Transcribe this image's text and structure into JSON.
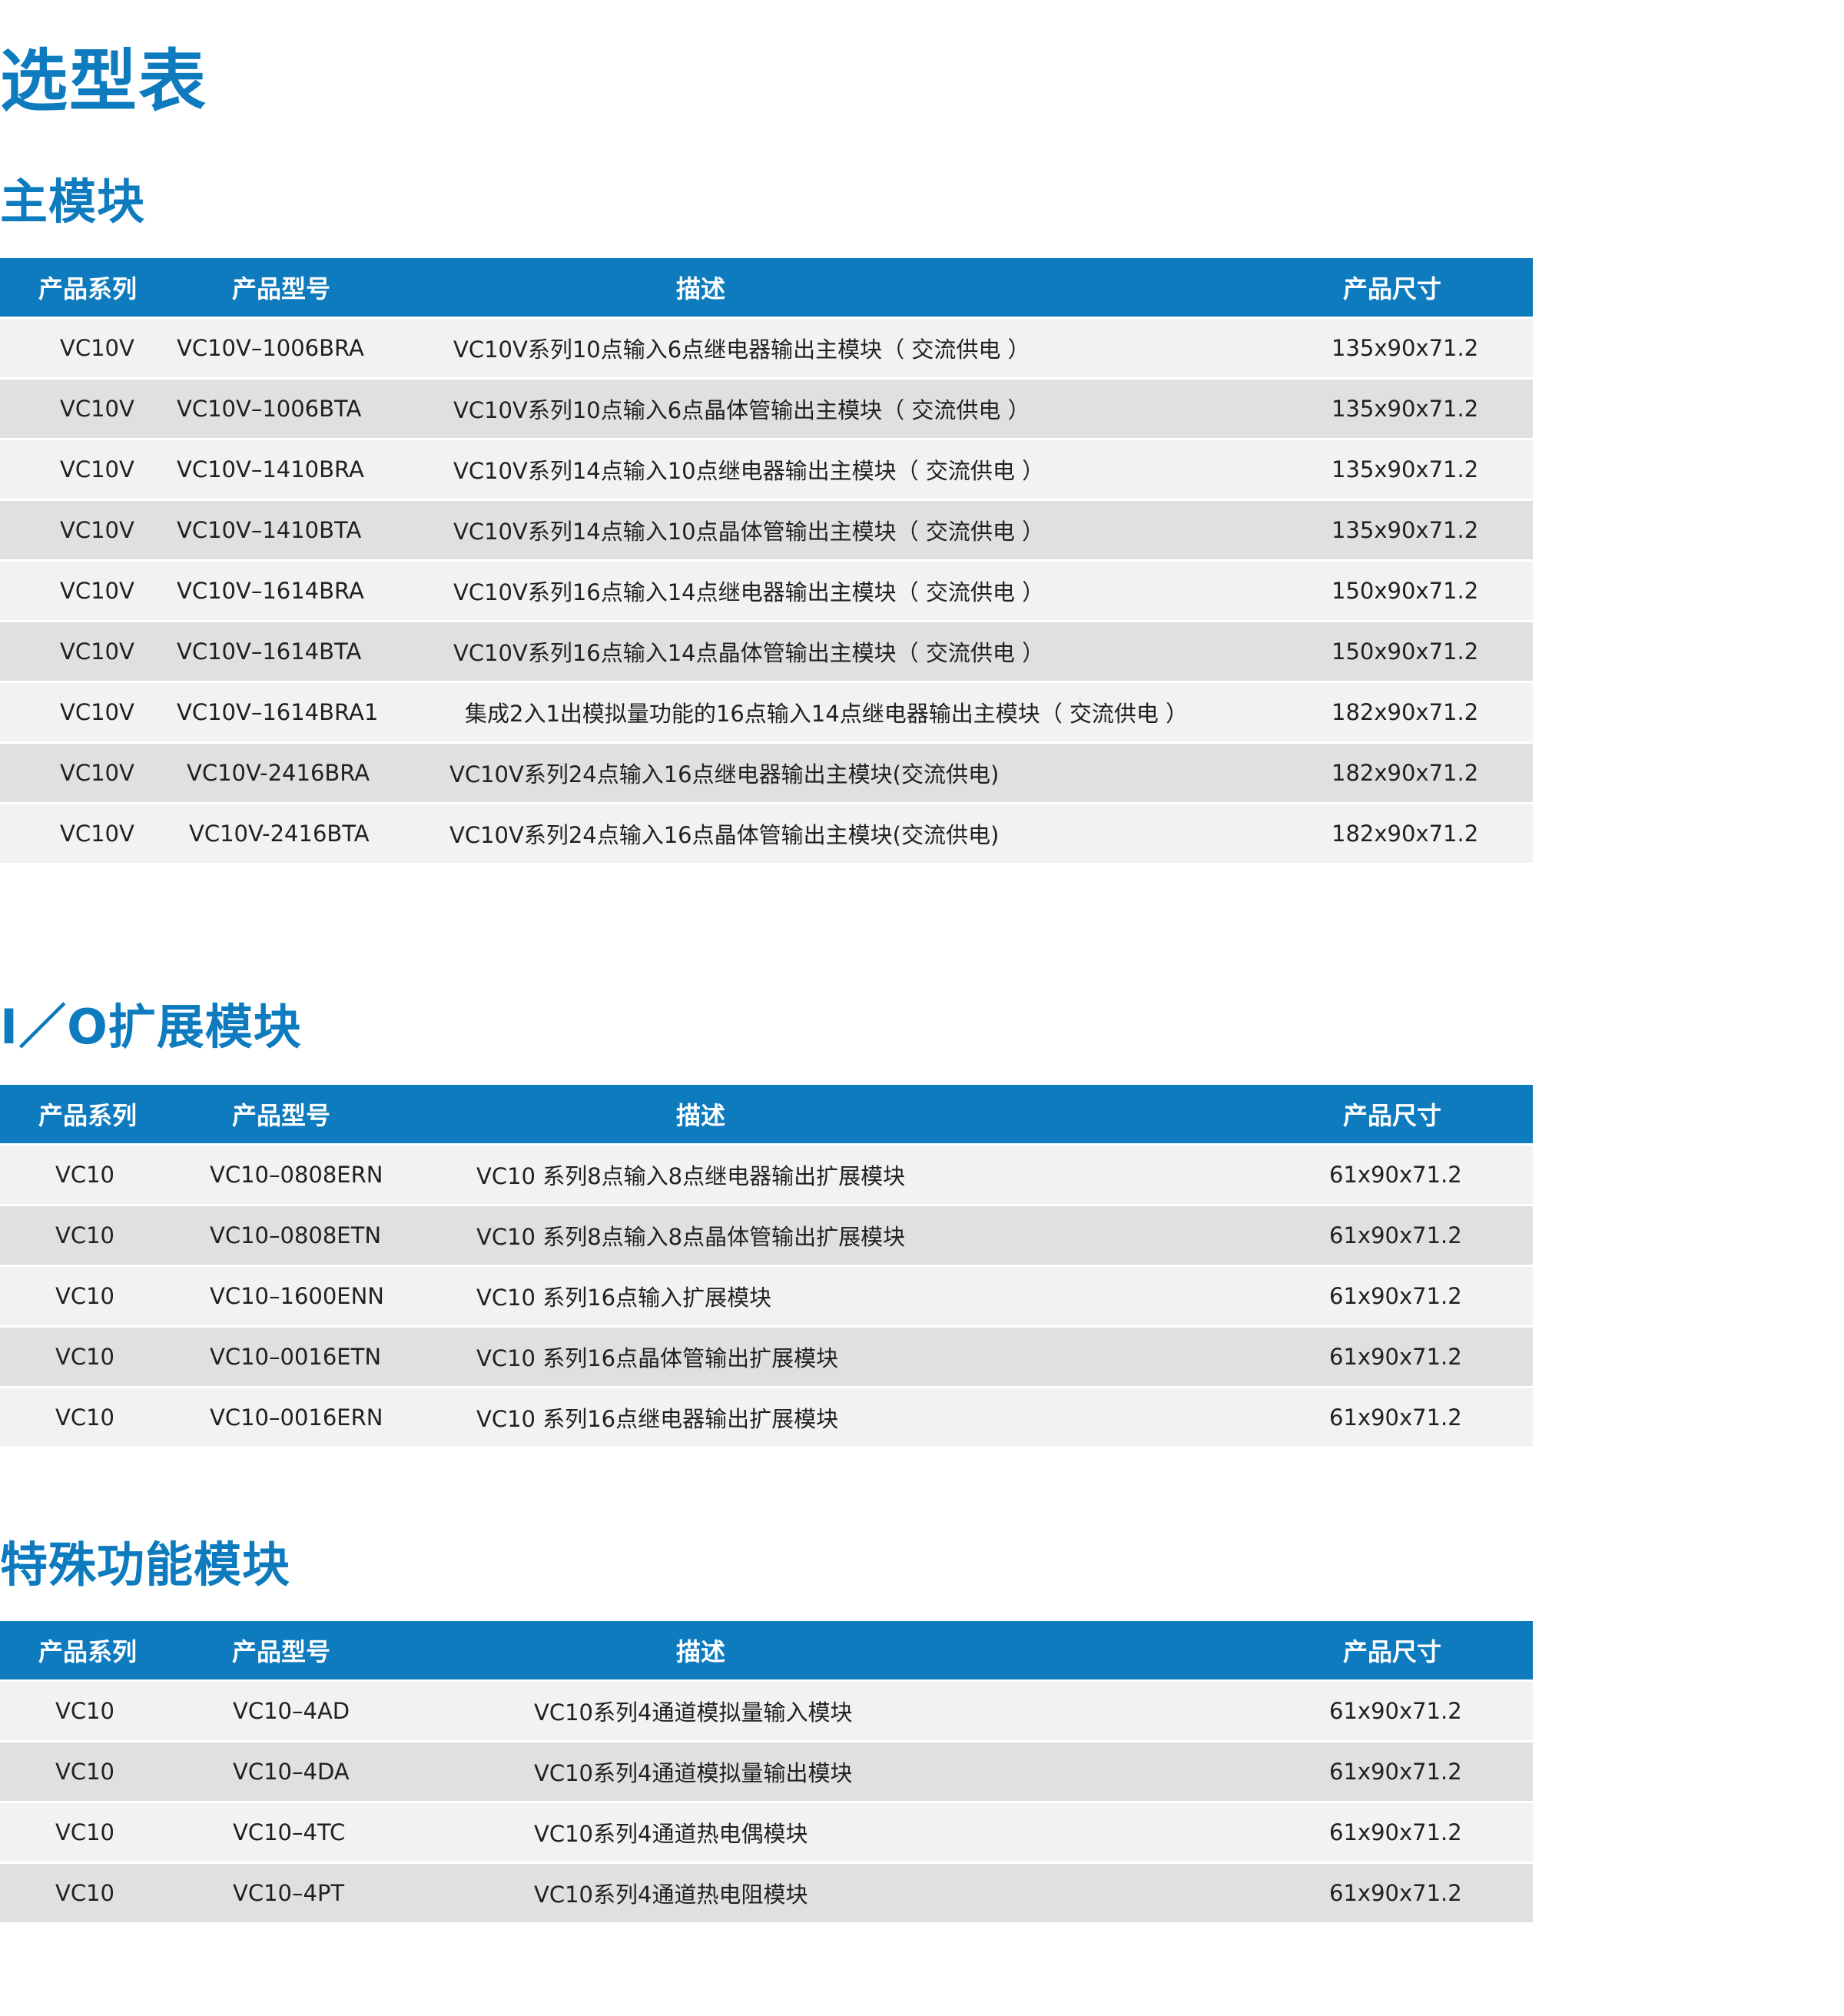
{
  "page_title": "选型表",
  "headers": {
    "series": "产品系列",
    "model": "产品型号",
    "description": "描述",
    "size": "产品尺寸"
  },
  "sections": [
    {
      "title": "主模块",
      "rows": [
        {
          "series": "VC10V",
          "model": "VC10V–1006BRA",
          "description": "VC10V系列10点输入6点继电器输出主模块（ 交流供电 ）",
          "size": "135x90x71.2"
        },
        {
          "series": "VC10V",
          "model": "VC10V–1006BTA",
          "description": "VC10V系列10点输入6点晶体管输出主模块（ 交流供电 ）",
          "size": "135x90x71.2"
        },
        {
          "series": "VC10V",
          "model": "VC10V–1410BRA",
          "description": "VC10V系列14点输入10点继电器输出主模块（ 交流供电 ）",
          "size": "135x90x71.2"
        },
        {
          "series": "VC10V",
          "model": "VC10V–1410BTA",
          "description": "VC10V系列14点输入10点晶体管输出主模块（ 交流供电 ）",
          "size": "135x90x71.2"
        },
        {
          "series": "VC10V",
          "model": "VC10V–1614BRA",
          "description": "VC10V系列16点输入14点继电器输出主模块（ 交流供电 ）",
          "size": "150x90x71.2"
        },
        {
          "series": "VC10V",
          "model": "VC10V–1614BTA",
          "description": "VC10V系列16点输入14点晶体管输出主模块（ 交流供电 ）",
          "size": "150x90x71.2"
        },
        {
          "series": "VC10V",
          "model": "VC10V–1614BRA1",
          "description": "集成2入1出模拟量功能的16点输入14点继电器输出主模块（ 交流供电 ）",
          "size": "182x90x71.2"
        },
        {
          "series": "VC10V",
          "model": "VC10V-2416BRA",
          "description": "VC10V系列24点输入16点继电器输出主模块(交流供电)",
          "size": "182x90x71.2"
        },
        {
          "series": "VC10V",
          "model": "VC10V-2416BTA",
          "description": "VC10V系列24点输入16点晶体管输出主模块(交流供电)",
          "size": "182x90x71.2"
        }
      ]
    },
    {
      "title": "I／O扩展模块",
      "rows": [
        {
          "series": "VC10",
          "model": "VC10–0808ERN",
          "description": "VC10 系列8点输入8点继电器输出扩展模块",
          "size": "61x90x71.2"
        },
        {
          "series": "VC10",
          "model": "VC10–0808ETN",
          "description": "VC10 系列8点输入8点晶体管输出扩展模块",
          "size": "61x90x71.2"
        },
        {
          "series": "VC10",
          "model": "VC10–1600ENN",
          "description": "VC10 系列16点输入扩展模块",
          "size": "61x90x71.2"
        },
        {
          "series": "VC10",
          "model": "VC10–0016ETN",
          "description": "VC10 系列16点晶体管输出扩展模块",
          "size": "61x90x71.2"
        },
        {
          "series": "VC10",
          "model": "VC10–0016ERN",
          "description": "VC10 系列16点继电器输出扩展模块",
          "size": "61x90x71.2"
        }
      ]
    },
    {
      "title": "特殊功能模块",
      "rows": [
        {
          "series": "VC10",
          "model": "VC10–4AD",
          "description": "VC10系列4通道模拟量输入模块",
          "size": "61x90x71.2"
        },
        {
          "series": "VC10",
          "model": "VC10–4DA",
          "description": "VC10系列4通道模拟量输出模块",
          "size": "61x90x71.2"
        },
        {
          "series": "VC10",
          "model": "VC10–4TC",
          "description": "VC10系列4通道热电偶模块",
          "size": "61x90x71.2"
        },
        {
          "series": "VC10",
          "model": "VC10–4PT",
          "description": "VC10系列4通道热电阻模块",
          "size": "61x90x71.2"
        }
      ]
    }
  ]
}
